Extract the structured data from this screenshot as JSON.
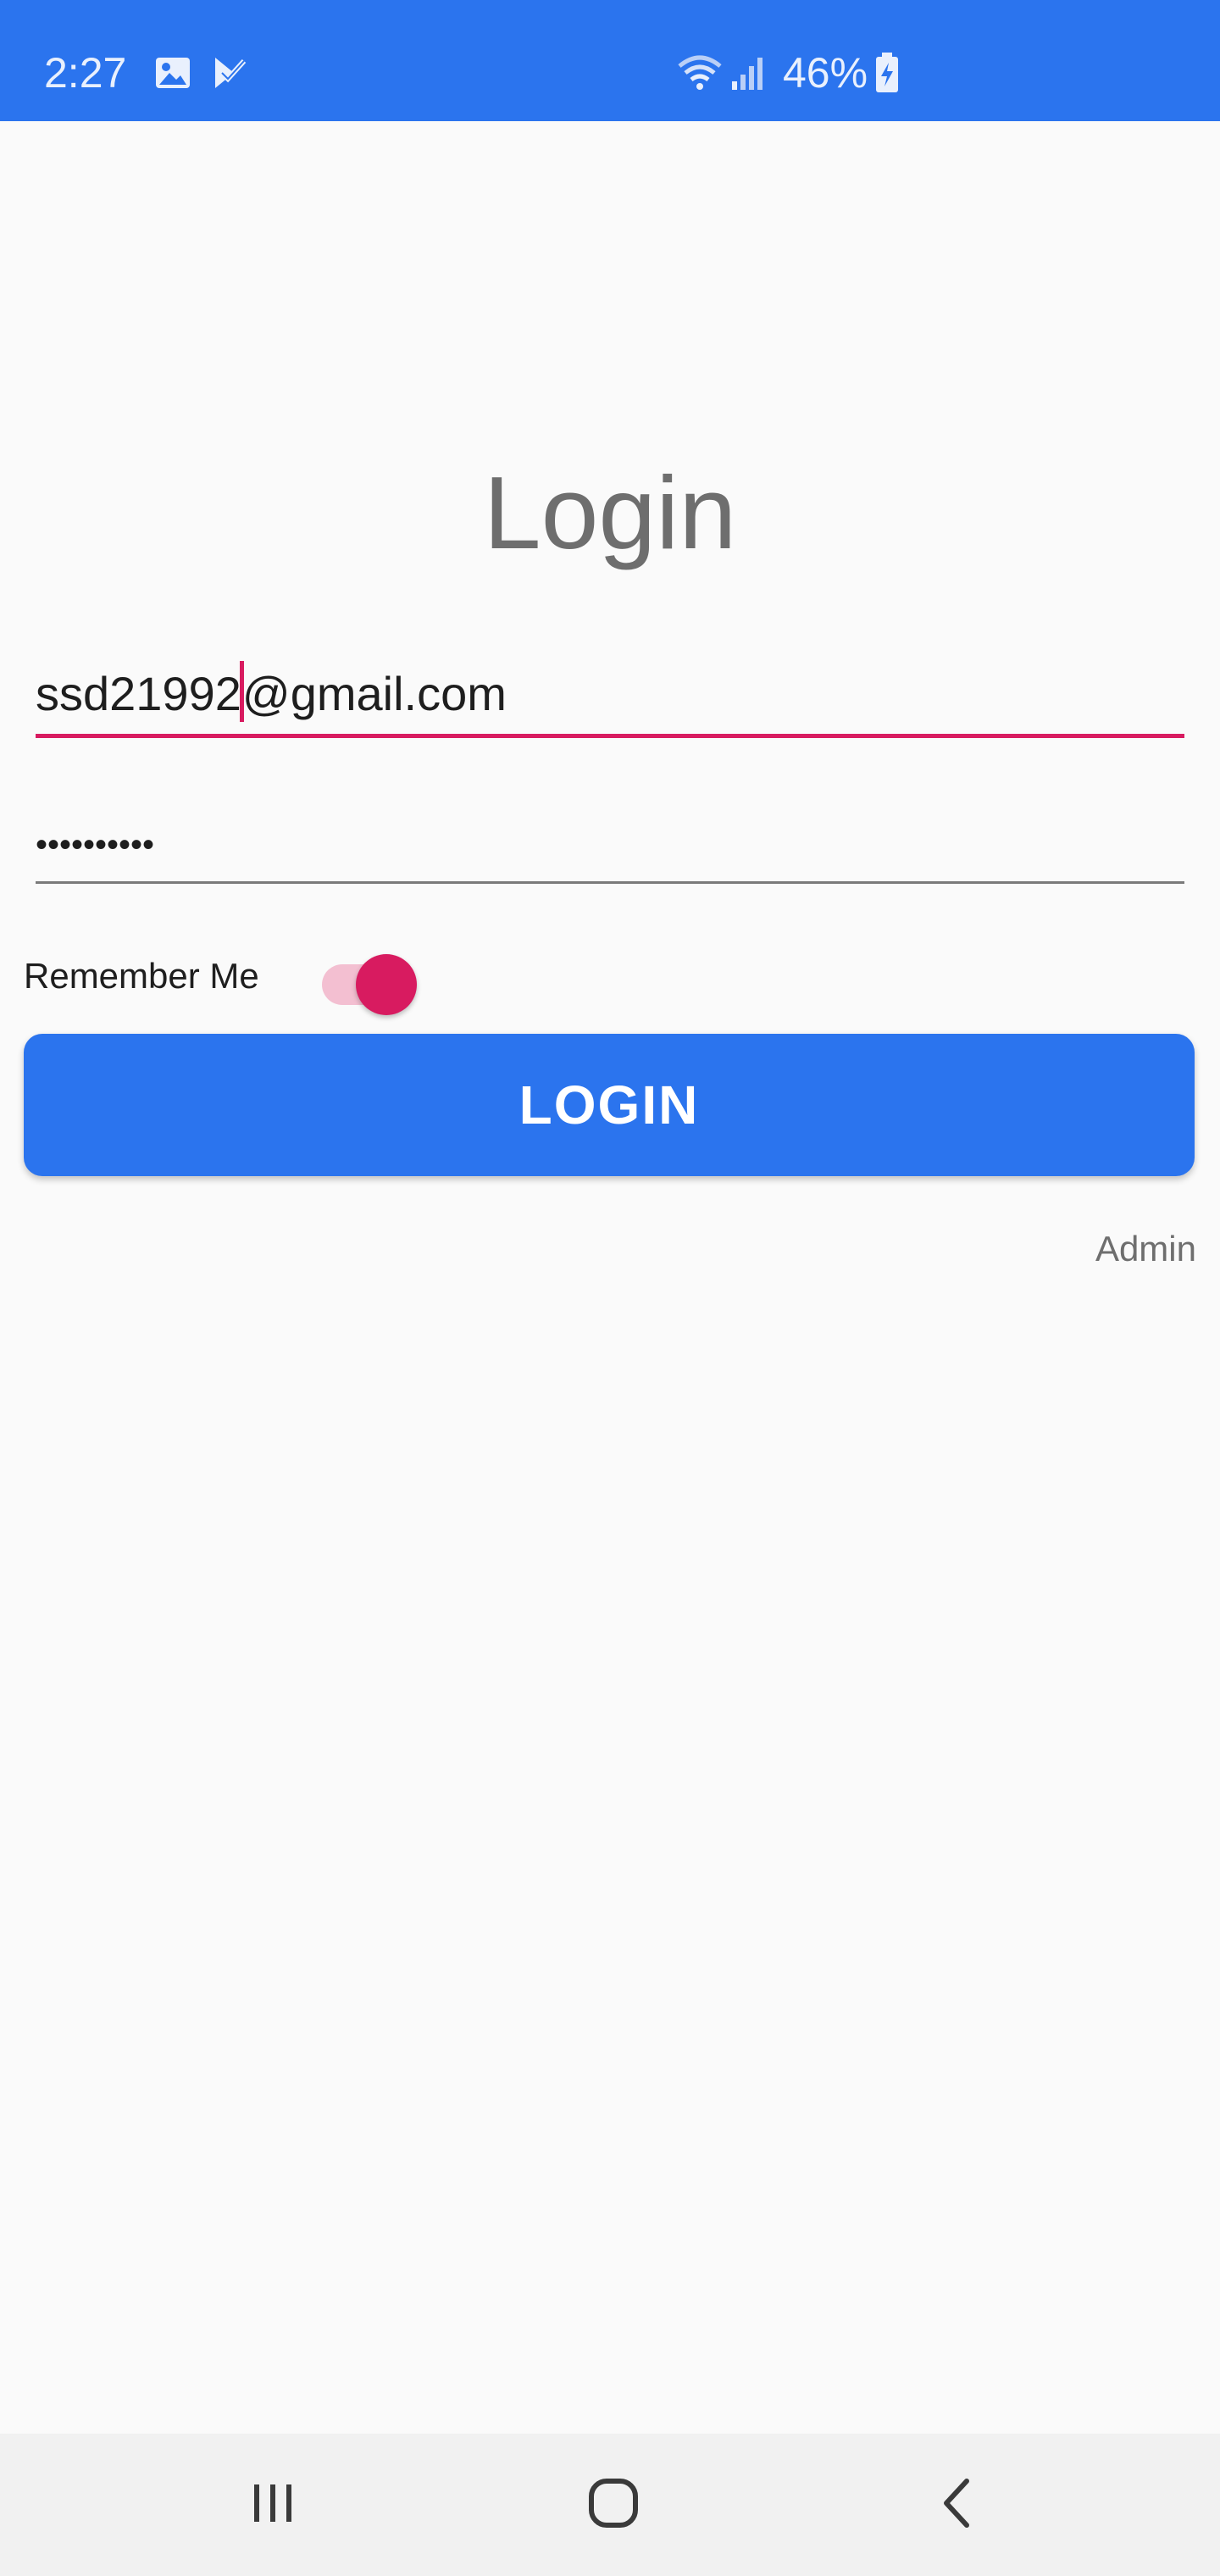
{
  "status_bar": {
    "time": "2:27",
    "battery_percent": "46%",
    "icons": [
      "gallery-icon",
      "task-check-icon",
      "wifi-icon",
      "signal-icon",
      "battery-charging-icon"
    ],
    "color": "#2b74ee"
  },
  "login": {
    "title": "Login",
    "email_value": "ssd21992@gmail.com",
    "email_before_caret": "ssd21992",
    "email_after_caret": "@gmail.com",
    "password_masked": "••••••••••",
    "remember_me_label": "Remember Me",
    "remember_me_checked": true,
    "login_button_label": "LOGIN",
    "admin_link_label": "Admin",
    "accent_color": "#d81b60",
    "button_color": "#2b74ee"
  },
  "nav_bar": {
    "buttons": [
      "recent-apps-icon",
      "home-icon",
      "back-icon"
    ]
  }
}
